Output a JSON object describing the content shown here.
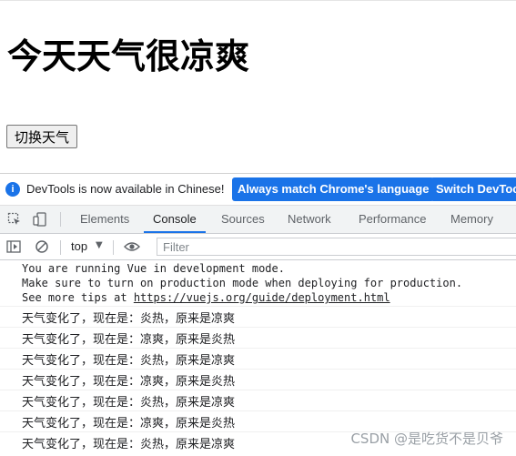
{
  "page": {
    "heading": "今天天气很凉爽",
    "toggle_button": "切换天气"
  },
  "infobar": {
    "message": "DevTools is now available in Chinese!",
    "btn_match": "Always match Chrome's language",
    "btn_switch": "Switch DevTools to Chinese"
  },
  "tabs": [
    "Elements",
    "Console",
    "Sources",
    "Network",
    "Performance",
    "Memory"
  ],
  "active_tab": "Console",
  "toolbar": {
    "context": "top",
    "filter_placeholder": "Filter"
  },
  "console": {
    "vue_notice": {
      "line1": "You are running Vue in development mode.",
      "line2": "Make sure to turn on production mode when deploying for production.",
      "line3_prefix": "See more tips at ",
      "line3_link": "https://vuejs.org/guide/deployment.html"
    },
    "logs": [
      "天气变化了，现在是：炎热，原来是凉爽",
      "天气变化了，现在是：凉爽，原来是炎热",
      "天气变化了，现在是：炎热，原来是凉爽",
      "天气变化了，现在是：凉爽，原来是炎热",
      "天气变化了，现在是：炎热，原来是凉爽",
      "天气变化了，现在是：凉爽，原来是炎热",
      "天气变化了，现在是：炎热，原来是凉爽"
    ]
  },
  "watermark": "CSDN @是吃货不是贝爷",
  "colors": {
    "accent": "#1a73e8",
    "text": "#202124",
    "muted": "#5f6368"
  }
}
